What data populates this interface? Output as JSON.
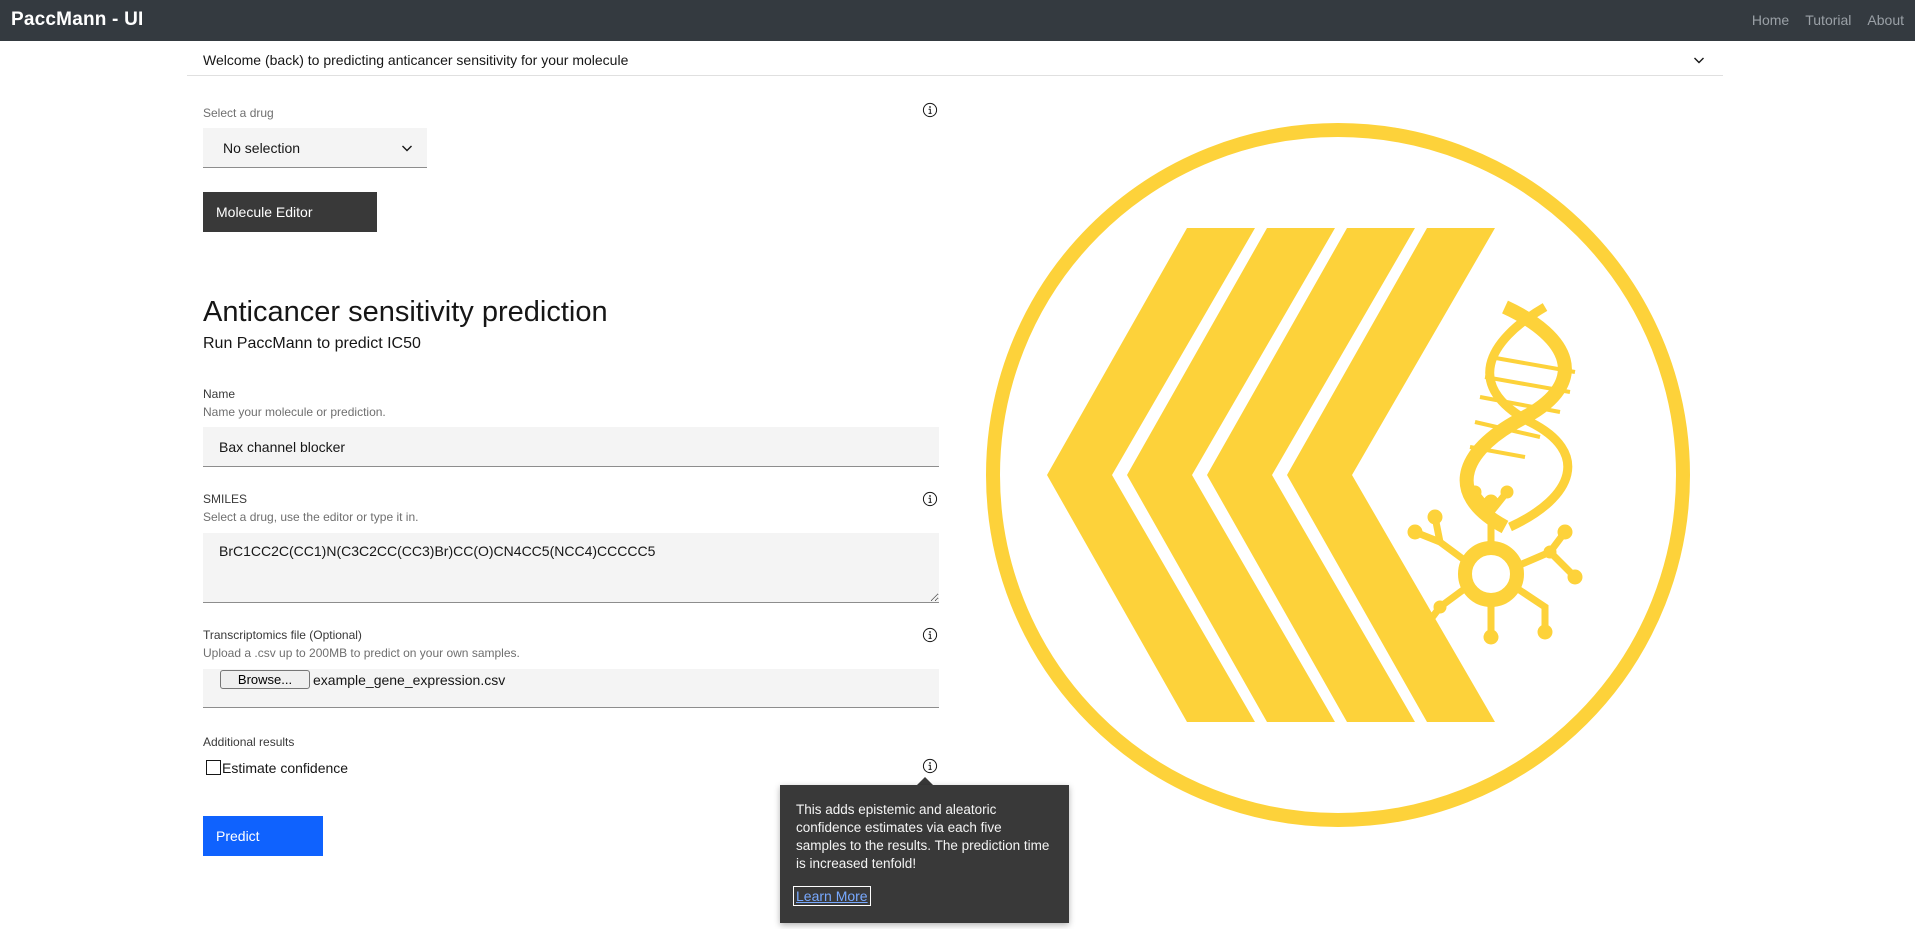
{
  "header": {
    "brand": "PaccMann - UI",
    "nav": [
      {
        "label": "Home"
      },
      {
        "label": "Tutorial"
      },
      {
        "label": "About"
      }
    ]
  },
  "accordion": {
    "title": "Welcome (back) to predicting anticancer sensitivity for your molecule",
    "icon": "chevron-down-icon"
  },
  "drug_select": {
    "label": "Select a drug",
    "value": "No selection"
  },
  "molecule_editor": {
    "label": "Molecule Editor"
  },
  "section": {
    "title": "Anticancer sensitivity prediction",
    "subtitle": "Run PaccMann to predict IC50"
  },
  "name_field": {
    "label": "Name",
    "helper": "Name your molecule or prediction.",
    "value": "Bax channel blocker"
  },
  "smiles_field": {
    "label": "SMILES",
    "helper": "Select a drug, use the editor or type it in.",
    "value": "BrC1CC2C(CC1)N(C3C2CC(CC3)Br)CC(O)CN4CC5(NCC4)CCCCC5"
  },
  "transcriptomics_field": {
    "label": "Transcriptomics file (Optional)",
    "helper": "Upload a .csv up to 200MB to predict on your own samples.",
    "browse_label": "Browse...",
    "file_name": "example_gene_expression.csv"
  },
  "additional": {
    "label": "Additional results",
    "checkbox_label": "Estimate confidence",
    "checked": false
  },
  "predict": {
    "label": "Predict"
  },
  "tooltip": {
    "text": "This adds epistemic and aleatoric confidence estimates via each five samples to the results. The prediction time is increased tenfold!",
    "link": "Learn More"
  },
  "colors": {
    "topbar": "#343a40",
    "primary": "#0f62fe",
    "logo": "#fdd23a",
    "dark_button": "#393939"
  }
}
